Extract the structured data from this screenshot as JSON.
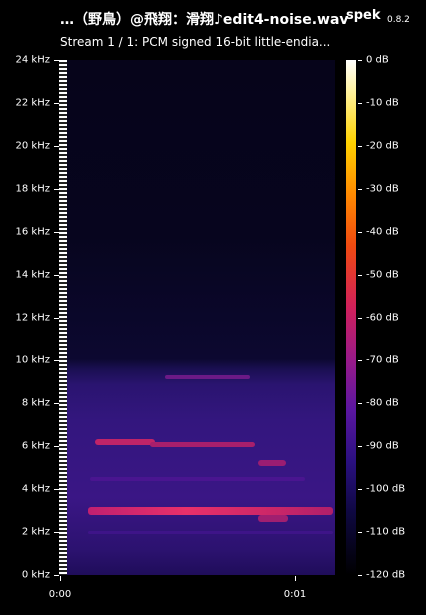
{
  "window": {
    "file_title": "…（野鳥）@飛翔：滑翔♪edit4-noise.wav",
    "app_name": "spek",
    "app_version": "0.8.2",
    "stream_info": "Stream 1 / 1: PCM signed 16-bit little-endia..."
  },
  "freq_axis": {
    "labels": [
      "24 kHz",
      "22 kHz",
      "20 kHz",
      "18 kHz",
      "16 kHz",
      "14 kHz",
      "12 kHz",
      "10 kHz",
      "8 kHz",
      "6 kHz",
      "4 kHz",
      "2 kHz",
      "0 kHz"
    ]
  },
  "time_axis": {
    "labels": [
      "0:00",
      "0:01"
    ]
  },
  "db_scale": {
    "labels": [
      "0 dB",
      "-10 dB",
      "-20 dB",
      "-30 dB",
      "-40 dB",
      "-50 dB",
      "-60 dB",
      "-70 dB",
      "-80 dB",
      "-90 dB",
      "-100 dB",
      "-110 dB",
      "-120 dB"
    ]
  },
  "colors": {
    "background": "#000000",
    "text": "#ffffff",
    "band_strong": "#e8306a",
    "band_mid": "#b02070",
    "band_weak": "#7a1a8a"
  }
}
